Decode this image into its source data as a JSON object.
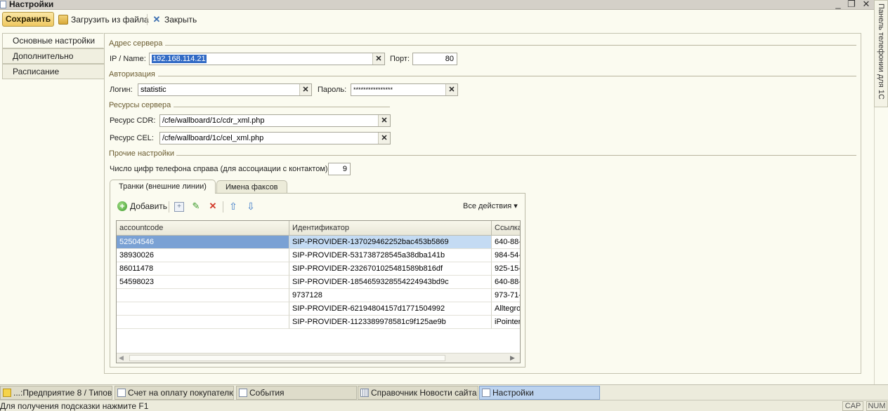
{
  "window": {
    "title": "Настройки",
    "minimize_glyph": "_",
    "restore_glyph": "❐",
    "close_glyph": "✕"
  },
  "toolbar": {
    "save_label": "Сохранить",
    "load_label": "Загрузить из файла",
    "close_label": "Закрыть"
  },
  "left_tabs": [
    {
      "label": "Основные настройки",
      "active": true
    },
    {
      "label": "Дополнительно",
      "active": false
    },
    {
      "label": "Расписание",
      "active": false
    }
  ],
  "server": {
    "group_title": "Адрес сервера",
    "ip_label": "IP / Name:",
    "ip_value": "192.168.114.21",
    "port_label": "Порт:",
    "port_value": "80"
  },
  "auth": {
    "group_title": "Авторизация",
    "login_label": "Логин:",
    "login_value": "statistic",
    "password_label": "Пароль:",
    "password_value": "****************"
  },
  "resources": {
    "group_title": "Ресурсы сервера",
    "cdr_label": "Ресурс CDR:",
    "cdr_value": "/cfe/wallboard/1c/cdr_xml.php",
    "cel_label": "Ресурс CEL:",
    "cel_value": "/cfe/wallboard/1c/cel_xml.php"
  },
  "other": {
    "group_title": "Прочие настройки",
    "digits_label": "Число цифр телефона справа (для ассоциации с контактом):",
    "digits_value": "9"
  },
  "inner_tabs": [
    {
      "label": "Транки (внешние линии)",
      "active": true
    },
    {
      "label": "Имена факсов",
      "active": false
    }
  ],
  "table_toolbar": {
    "add_label": "Добавить",
    "all_actions_label": "Все действия ▾"
  },
  "table": {
    "columns": [
      "accountcode",
      "Идентификатор",
      "Ссылка"
    ],
    "rows": [
      [
        "52504546",
        "SIP-PROVIDER-137029462252bac453b5869",
        "640-88-"
      ],
      [
        "38930026",
        "SIP-PROVIDER-531738728545a38dba141b",
        "984-54-"
      ],
      [
        "86011478",
        "SIP-PROVIDER-2326701025481589b816df",
        "925-15-"
      ],
      [
        "54598023",
        "SIP-PROVIDER-1854659328554224943bd9c",
        "640-88-"
      ],
      [
        "",
        "9737128",
        "973-71-"
      ],
      [
        "",
        "SIP-PROVIDER-62194804157d1771504992",
        "AlltegroS"
      ],
      [
        "",
        "SIP-PROVIDER-1123389978581c9f125ae9b",
        "iPointer"
      ]
    ]
  },
  "right_panel": {
    "label": "Панель телефонии для 1С"
  },
  "taskbar": [
    {
      "label": "...:Предприятие 8 / Типовы...",
      "active": false
    },
    {
      "label": "Счет на оплату покупателю",
      "active": false
    },
    {
      "label": "События",
      "active": false
    },
    {
      "label": "Справочник Новости сайта",
      "active": false
    },
    {
      "label": "Настройки",
      "active": true
    }
  ],
  "statusbar": {
    "hint": "Для получения подсказки нажмите F1",
    "cap": "CAP",
    "num": "NUM"
  }
}
